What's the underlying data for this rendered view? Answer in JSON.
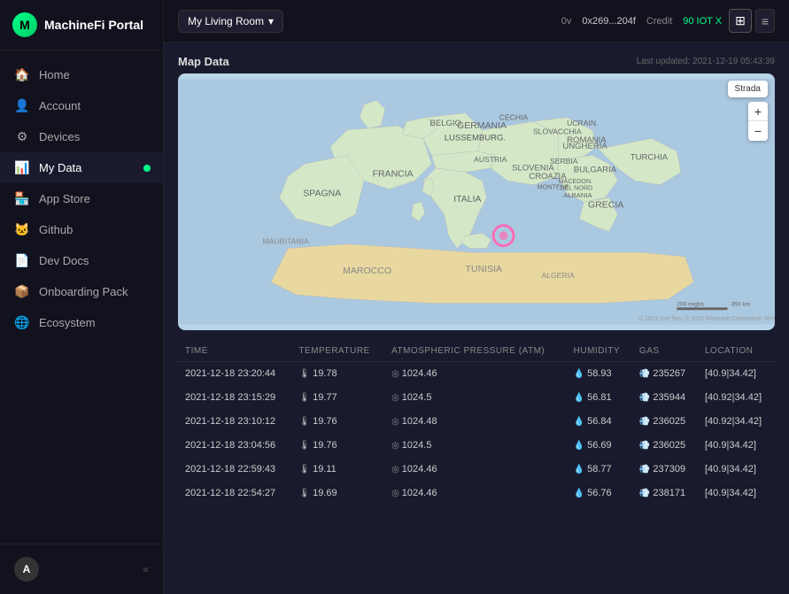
{
  "app": {
    "name": "MachineFi Portal",
    "logo_char": "M"
  },
  "topbar": {
    "wallet_prefix": "0v",
    "wallet_address": "0x269...204f",
    "credit_label": "Credit",
    "credit_value": "90 IOT X",
    "room_label": "My Living Room"
  },
  "sidebar": {
    "items": [
      {
        "id": "home",
        "label": "Home",
        "icon": "🏠",
        "active": false
      },
      {
        "id": "account",
        "label": "Account",
        "icon": "👤",
        "active": false
      },
      {
        "id": "devices",
        "label": "Devices",
        "icon": "⚙",
        "active": false
      },
      {
        "id": "my-data",
        "label": "My Data",
        "icon": "📊",
        "active": true
      },
      {
        "id": "app-store",
        "label": "App Store",
        "icon": "🏪",
        "active": false
      },
      {
        "id": "github",
        "label": "Github",
        "icon": "🐱",
        "active": false
      },
      {
        "id": "dev-docs",
        "label": "Dev Docs",
        "icon": "📄",
        "active": false
      },
      {
        "id": "onboarding",
        "label": "Onboarding Pack",
        "icon": "📦",
        "active": false
      },
      {
        "id": "ecosystem",
        "label": "Ecosystem",
        "icon": "🌐",
        "active": false
      }
    ],
    "footer": {
      "avatar_char": "A",
      "arrow": "«"
    }
  },
  "map": {
    "title": "Map Data",
    "last_updated_label": "Last updated:",
    "last_updated_value": "2021-12-19 05:43:39",
    "style_button": "Strada",
    "zoom_in": "+",
    "zoom_out": "−"
  },
  "table": {
    "columns": [
      "TIME",
      "TEMPERATURE",
      "ATMOSPHERIC PRESSURE (ATM)",
      "HUMIDITY",
      "GAS",
      "LOCATION"
    ],
    "rows": [
      {
        "time": "2021-12-18 23:20:44",
        "temp": "19.78",
        "pressure": "1024.46",
        "humidity": "58.93",
        "gas": "235267",
        "location": "[40.9|34.42]"
      },
      {
        "time": "2021-12-18 23:15:29",
        "temp": "19.77",
        "pressure": "1024.5",
        "humidity": "56.81",
        "gas": "235944",
        "location": "[40.92|34.42]"
      },
      {
        "time": "2021-12-18 23:10:12",
        "temp": "19.76",
        "pressure": "1024.48",
        "humidity": "56.84",
        "gas": "236025",
        "location": "[40.92|34.42]"
      },
      {
        "time": "2021-12-18 23:04:56",
        "temp": "19.76",
        "pressure": "1024.5",
        "humidity": "56.69",
        "gas": "236025",
        "location": "[40.9|34.42]"
      },
      {
        "time": "2021-12-18 22:59:43",
        "temp": "19.11",
        "pressure": "1024.46",
        "humidity": "58.77",
        "gas": "237309",
        "location": "[40.9|34.42]"
      },
      {
        "time": "2021-12-18 22:54:27",
        "temp": "19.69",
        "pressure": "1024.46",
        "humidity": "56.76",
        "gas": "238171",
        "location": "[40.9|34.42]"
      }
    ]
  },
  "view_toggle": {
    "grid_icon": "⊞",
    "list_icon": "≡"
  }
}
